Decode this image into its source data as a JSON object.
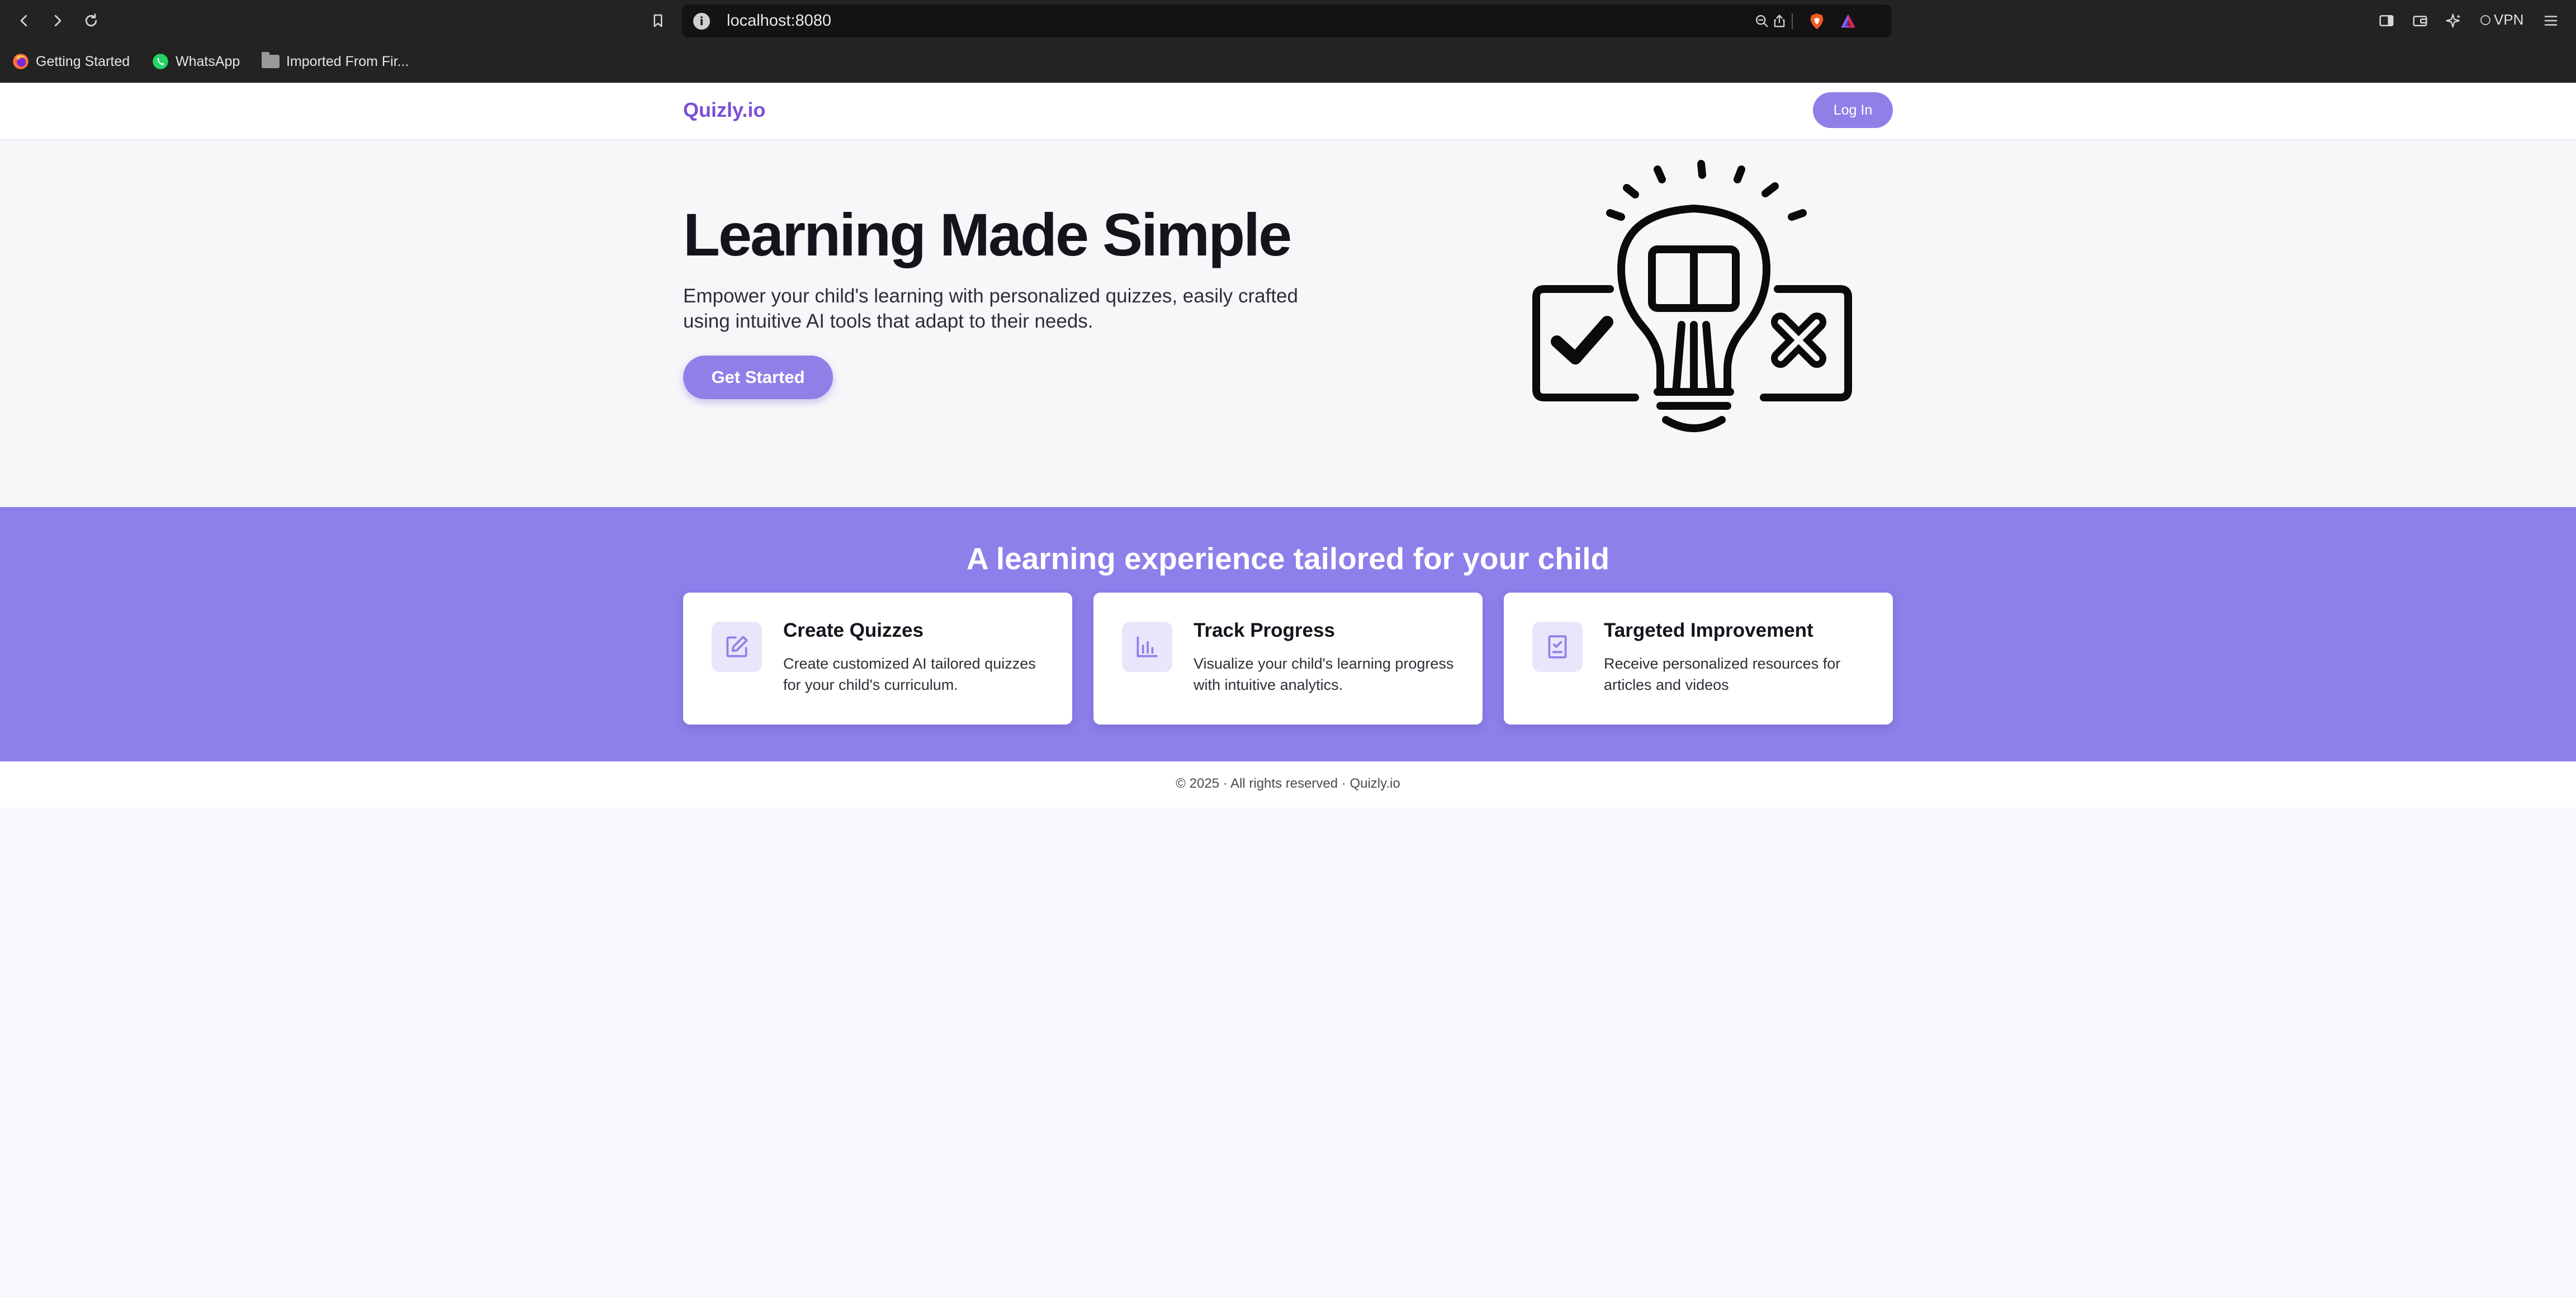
{
  "browser": {
    "url": "localhost:8080",
    "bookmarks": [
      {
        "label": "Getting Started"
      },
      {
        "label": "WhatsApp"
      },
      {
        "label": "Imported From Fir..."
      }
    ],
    "vpn_label": "VPN"
  },
  "nav": {
    "logo": "Quizly.io",
    "login_label": "Log In"
  },
  "hero": {
    "title": "Learning Made Simple",
    "subtitle": "Empower your child's learning with personalized quizzes, easily crafted using intuitive AI tools that adapt to their needs.",
    "cta_label": "Get Started"
  },
  "features": {
    "heading": "A learning experience tailored for your child",
    "cards": [
      {
        "title": "Create Quizzes",
        "text": "Create customized AI tailored quizzes for your child's curriculum.",
        "icon": "edit-icon"
      },
      {
        "title": "Track Progress",
        "text": "Visualize your child's learning progress with intuitive analytics.",
        "icon": "bar-chart-icon"
      },
      {
        "title": "Targeted Improvement",
        "text": "Receive personalized resources for articles and videos",
        "icon": "checklist-icon"
      }
    ]
  },
  "footer": {
    "text": "© 2025 · All rights reserved · Quizly.io"
  },
  "colors": {
    "accent": "#8f80e8",
    "band": "#8d80ea",
    "logo": "#7b4fd6",
    "icon_bg": "#e9e5fb"
  }
}
